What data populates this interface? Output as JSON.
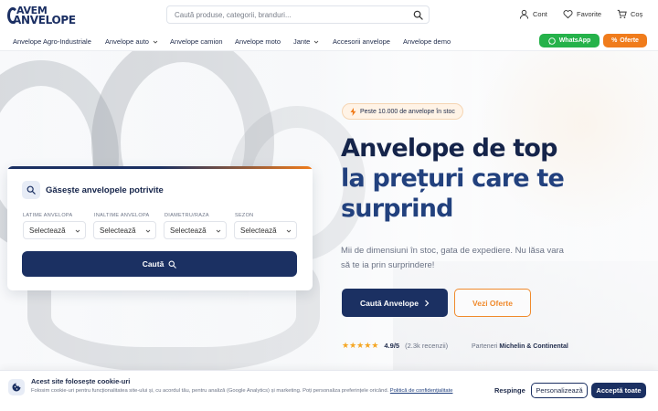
{
  "brand": {
    "logo_line1": "AVEM",
    "logo_line2": "ANVELOPE"
  },
  "search": {
    "placeholder": "Caută produse, categorii, branduri..."
  },
  "header_nav": {
    "account": "Cont",
    "favorites": "Favorite",
    "cart": "Coș"
  },
  "nav": {
    "items": [
      "Anvelope Agro-Industriale",
      "Anvelope auto",
      "Anvelope camion",
      "Anvelope moto",
      "Jante",
      "Accesorii anvelope",
      "Anvelope demo"
    ],
    "whatsapp": "WhatsApp",
    "offers": "Oferte"
  },
  "hero": {
    "badge": "Peste 10.000 de anvelope în stoc",
    "title_line1": "Anvelope de top",
    "title_line2": "la prețuri care te surprind",
    "subtitle": "Mii de dimensiuni în stoc, gata de expediere. Nu lăsa vara să te ia prin surprindere!",
    "cta_primary": "Caută Anvelope",
    "cta_secondary": "Vezi Oferte",
    "stars": 5,
    "rating": "4.9/5",
    "reviews": "(2.3k recenzii)",
    "partners_label": "Parteneri",
    "partners_value": "Michelin & Continental"
  },
  "finder": {
    "title": "Găsește anvelopele potrivite",
    "fields": [
      {
        "label": "LATIME ANVELOPA",
        "value": "Selectează"
      },
      {
        "label": "INALTIME ANVELOPA",
        "value": "Selectează"
      },
      {
        "label": "DIAMETRU/RAZA",
        "value": "Selectează"
      },
      {
        "label": "SEZON",
        "value": "Selectează"
      }
    ],
    "button": "Caută"
  },
  "cookie": {
    "title": "Acest site folosește cookie-uri",
    "text": "Folosim cookie-uri pentru funcționalitatea site-ului și, cu acordul tău, pentru analiză (Google Analytics) și marketing. Poți personaliza preferințele oricând.",
    "policy": "Politică de confidențialitate",
    "reject": "Respinge",
    "customize": "Personalizează",
    "accept": "Acceptă toate"
  },
  "colors": {
    "navy": "#1b3062",
    "orange": "#f07c1c",
    "green": "#25b24a"
  }
}
